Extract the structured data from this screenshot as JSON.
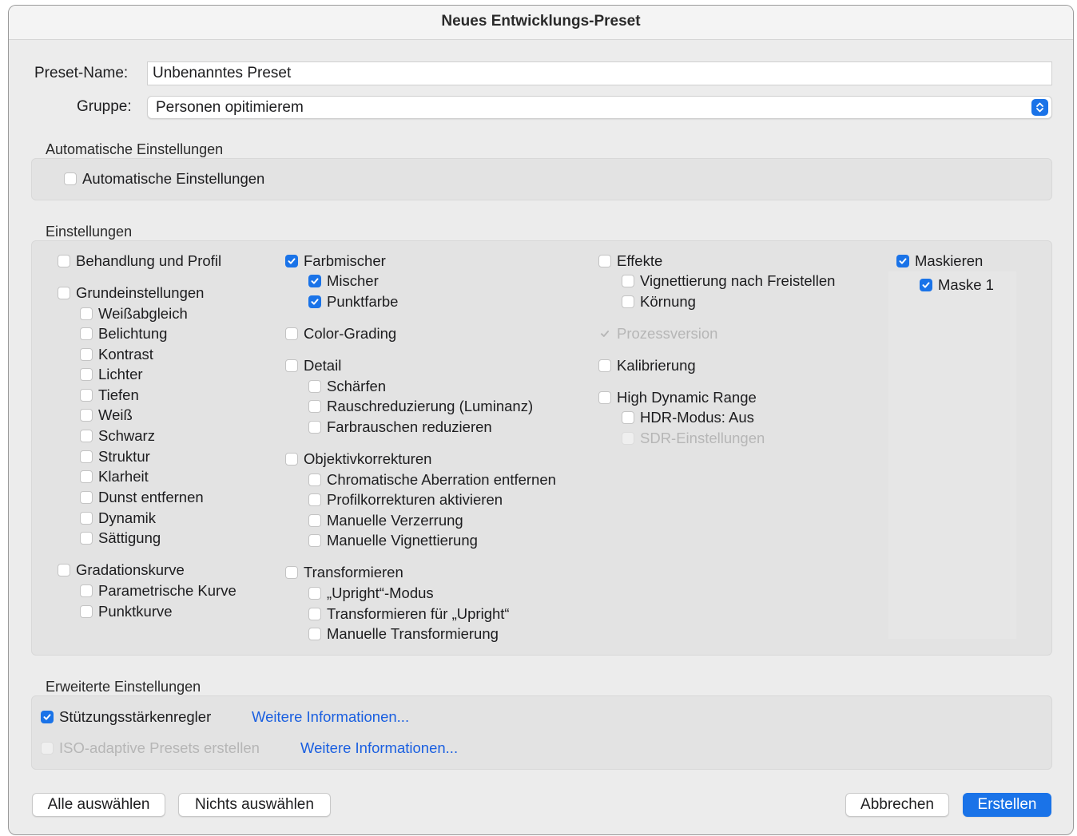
{
  "window": {
    "title": "Neues Entwicklungs-Preset"
  },
  "form": {
    "preset_name_label": "Preset-Name:",
    "preset_name_value": "Unbenanntes Preset",
    "group_label": "Gruppe:",
    "group_value": "Personen opitimierem"
  },
  "auto": {
    "title": "Automatische Einstellungen",
    "checkbox_label": "Automatische Einstellungen",
    "checked": false
  },
  "settings": {
    "title": "Einstellungen",
    "col1": {
      "behandlung": "Behandlung und Profil",
      "grund": "Grundeinstellungen",
      "weissabgleich": "Weißabgleich",
      "belichtung": "Belichtung",
      "kontrast": "Kontrast",
      "lichter": "Lichter",
      "tiefen": "Tiefen",
      "weiss": "Weiß",
      "schwarz": "Schwarz",
      "struktur": "Struktur",
      "klarheit": "Klarheit",
      "dunst": "Dunst entfernen",
      "dynamik": "Dynamik",
      "saettigung": "Sättigung",
      "gradation": "Gradationskurve",
      "parametrisch": "Parametrische Kurve",
      "punktkurve": "Punktkurve"
    },
    "col2": {
      "farbmischer": "Farbmischer",
      "mischer": "Mischer",
      "punktfarbe": "Punktfarbe",
      "colorgrading": "Color-Grading",
      "detail": "Detail",
      "schaerfen": "Schärfen",
      "rausch": "Rauschreduzierung (Luminanz)",
      "farbrauschen": "Farbrauschen reduzieren",
      "objektiv": "Objektivkorrekturen",
      "chromatisch": "Chromatische Aberration entfernen",
      "profilkorr": "Profilkorrekturen aktivieren",
      "verzerrung": "Manuelle Verzerrung",
      "vignettierung": "Manuelle Vignettierung",
      "transformieren": "Transformieren",
      "upright_modus": "„Upright“-Modus",
      "transf_upright": "Transformieren für „Upright“",
      "manuelle_transf": "Manuelle Transformierung"
    },
    "col3": {
      "effekte": "Effekte",
      "vignettierung_frei": "Vignettierung nach Freistellen",
      "koernung": "Körnung",
      "prozess": "Prozessversion",
      "kalibrierung": "Kalibrierung",
      "hdr": "High Dynamic Range",
      "hdr_modus": "HDR-Modus: Aus",
      "sdr": "SDR-Einstellungen"
    },
    "col4": {
      "maskieren": "Maskieren",
      "maske1": "Maske 1"
    }
  },
  "advanced": {
    "title": "Erweiterte Einstellungen",
    "stuetzung": "Stützungsstärkenregler",
    "iso": "ISO-adaptive Presets erstellen",
    "more_info_1": "Weitere Informationen...",
    "more_info_2": "Weitere Informationen..."
  },
  "buttons": {
    "select_all": "Alle auswählen",
    "select_none": "Nichts auswählen",
    "cancel": "Abbrechen",
    "create": "Erstellen"
  },
  "colors": {
    "accent": "#1a73e8",
    "link": "#1a5fe0",
    "panel": "#e3e3e3",
    "window": "#ececec"
  },
  "icons": {
    "check": "checkmark-icon",
    "select_arrows": "updown-chevron-icon"
  }
}
